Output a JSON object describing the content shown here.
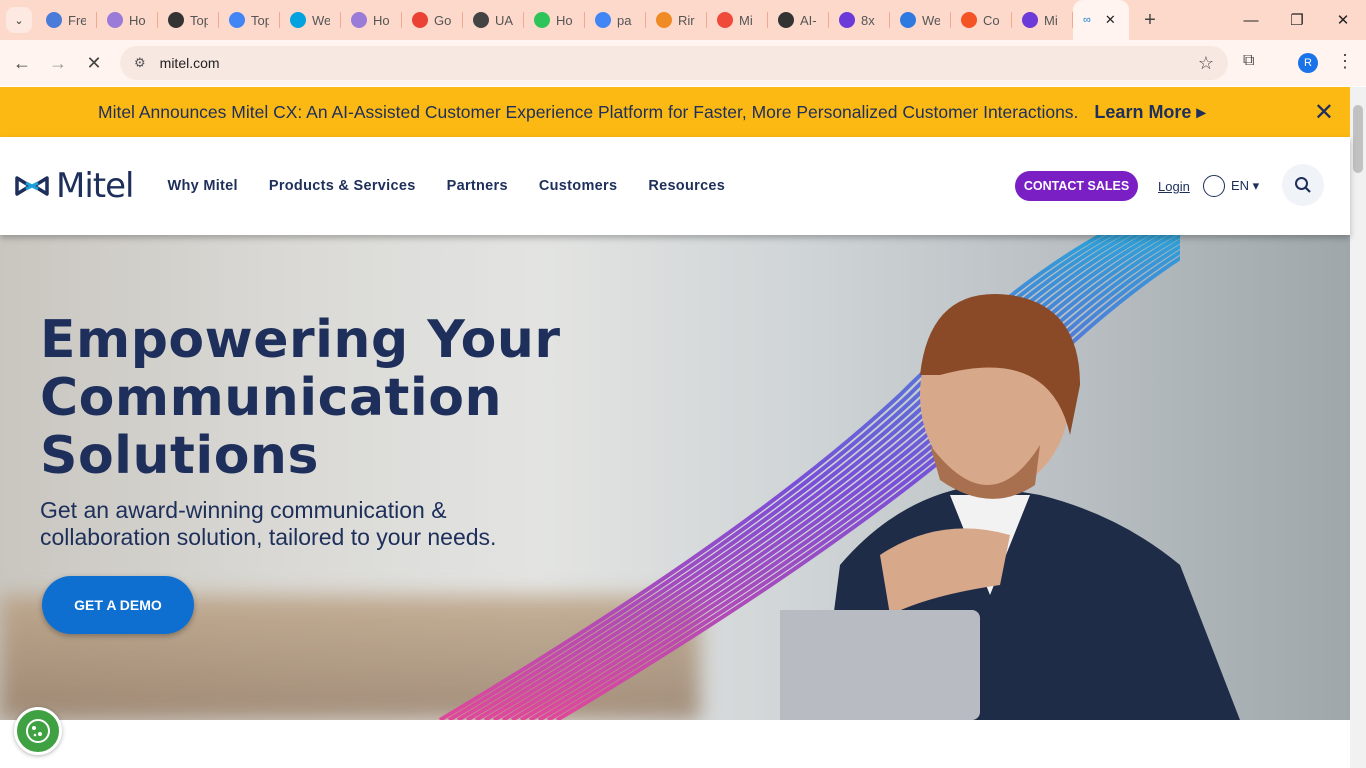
{
  "browser": {
    "tabs": [
      {
        "title": "Fre",
        "color": "#4a7bd8"
      },
      {
        "title": "Ho",
        "color": "#9b7bd8"
      },
      {
        "title": "Top",
        "color": "#333333"
      },
      {
        "title": "Top",
        "color": "#4285f4"
      },
      {
        "title": "We",
        "color": "#00a3e0"
      },
      {
        "title": "Ho",
        "color": "#9b7bd8"
      },
      {
        "title": "Go",
        "color": "#ea4335"
      },
      {
        "title": "UA",
        "color": "#444444"
      },
      {
        "title": "Ho",
        "color": "#2ec45a"
      },
      {
        "title": "pa",
        "color": "#4285f4"
      },
      {
        "title": "Rir",
        "color": "#f08a24"
      },
      {
        "title": "Mi",
        "color": "#ef4a3a"
      },
      {
        "title": "AI-",
        "color": "#333333"
      },
      {
        "title": "8x",
        "color": "#6b3ad8"
      },
      {
        "title": "We",
        "color": "#2f7ae0"
      },
      {
        "title": "Co",
        "color": "#f35325"
      },
      {
        "title": "Mi",
        "color": "#6b3ad8"
      }
    ],
    "active_tab_icon": "mitel-logo-icon",
    "new_tab": "+",
    "url": "mitel.com"
  },
  "banner": {
    "message": "Mitel Announces Mitel CX: An AI-Assisted Customer Experience Platform for Faster, More Personalized Customer Interactions.",
    "link": "Learn More ▸",
    "close": "✕"
  },
  "header": {
    "logo": "Mitel",
    "nav": [
      "Why Mitel",
      "Products & Services",
      "Partners",
      "Customers",
      "Resources"
    ],
    "contact_sales": "CONTACT SALES",
    "login": "Login",
    "language": "EN ▾"
  },
  "hero": {
    "title_lines": [
      "Empowering Your",
      "Communication",
      "Solutions"
    ],
    "subtitle": "Get an award-winning communication & collaboration solution, tailored to your needs.",
    "cta": "GET A DEMO"
  },
  "colors": {
    "brand_navy": "#1d2f5a",
    "banner": "#fdb913",
    "contact_sales": "#7a1fc4",
    "cta": "#0f6fd1"
  }
}
